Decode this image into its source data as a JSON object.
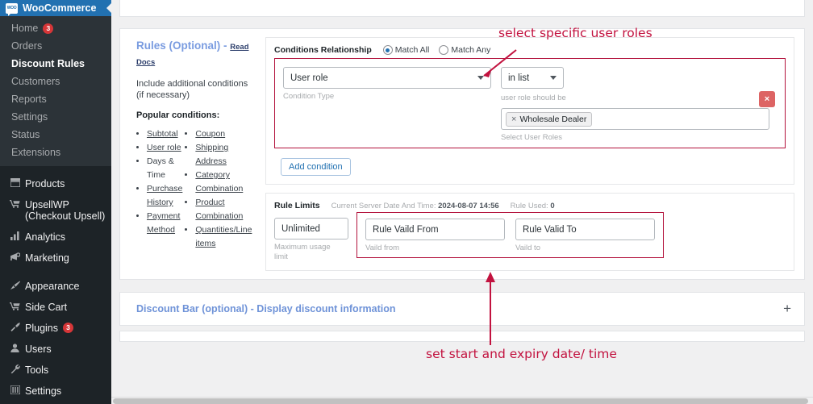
{
  "sidebar": {
    "brand": {
      "label": "WooCommerce",
      "icon": "woo-icon",
      "color": "#2271b1"
    },
    "submenu": [
      {
        "label": "Home",
        "badge": "3",
        "current": false
      },
      {
        "label": "Orders",
        "badge": "",
        "current": false
      },
      {
        "label": "Discount Rules",
        "badge": "",
        "current": true
      },
      {
        "label": "Customers",
        "badge": "",
        "current": false
      },
      {
        "label": "Reports",
        "badge": "",
        "current": false
      },
      {
        "label": "Settings",
        "badge": "",
        "current": false
      },
      {
        "label": "Status",
        "badge": "",
        "current": false
      },
      {
        "label": "Extensions",
        "badge": "",
        "current": false
      }
    ],
    "items": [
      {
        "label": "Products",
        "icon": "products-icon",
        "badge": ""
      },
      {
        "label": "UpsellWP (Checkout Upsell)",
        "icon": "cart-icon",
        "badge": ""
      },
      {
        "label": "Analytics",
        "icon": "bar-chart-icon",
        "badge": ""
      },
      {
        "label": "Marketing",
        "icon": "megaphone-icon",
        "badge": ""
      }
    ],
    "items2": [
      {
        "label": "Appearance",
        "icon": "paintbrush-icon",
        "badge": ""
      },
      {
        "label": "Side Cart",
        "icon": "cart-icon",
        "badge": ""
      },
      {
        "label": "Plugins",
        "icon": "plug-icon",
        "badge": "3"
      },
      {
        "label": "Users",
        "icon": "user-icon",
        "badge": ""
      },
      {
        "label": "Tools",
        "icon": "wrench-icon",
        "badge": ""
      },
      {
        "label": "Settings",
        "icon": "sliders-icon",
        "badge": ""
      }
    ]
  },
  "rules": {
    "title": "Rules (Optional) -",
    "read_docs": "Read Docs",
    "description": "Include additional conditions (if necessary)",
    "popular_heading": "Popular conditions:",
    "popular_col1": [
      "Subtotal",
      "User role",
      "Days & Time",
      "Purchase History",
      "Payment Method"
    ],
    "popular_col2": [
      "Coupon",
      "Shipping Address",
      "Category Combination",
      "Product Combination",
      "Quantities/Line items"
    ]
  },
  "conditions": {
    "relationship_label": "Conditions Relationship",
    "match_all": "Match All",
    "match_any": "Match Any",
    "match_selected": "Match All",
    "condition_type_value": "User role",
    "condition_type_hint": "Condition Type",
    "operator_value": "in list",
    "operator_hint": "user role should be",
    "roles_hint": "Select User Roles",
    "role_chips": [
      {
        "label": "Wholesale Dealer",
        "remove": "×"
      }
    ],
    "delete_label": "×",
    "add_condition_label": "Add condition"
  },
  "rule_limits": {
    "title": "Rule Limits",
    "server_time_label": "Current Server Date And Time:",
    "server_time_value": "2024-08-07 14:56",
    "rule_used_label": "Rule Used:",
    "rule_used_value": "0",
    "max_usage_value": "Unlimited",
    "max_usage_hint": "Maximum usage limit",
    "valid_from_value": "Rule Vaild From",
    "valid_from_hint": "Vaild from",
    "valid_to_value": "Rule Valid To",
    "valid_to_hint": "Vaild to"
  },
  "discount_bar": {
    "title": "Discount Bar (optional) - Display discount information",
    "expand": "+"
  },
  "annotations": {
    "top": "select specific user roles",
    "bottom": "set start and expiry date/ time",
    "color": "#c2123f"
  }
}
